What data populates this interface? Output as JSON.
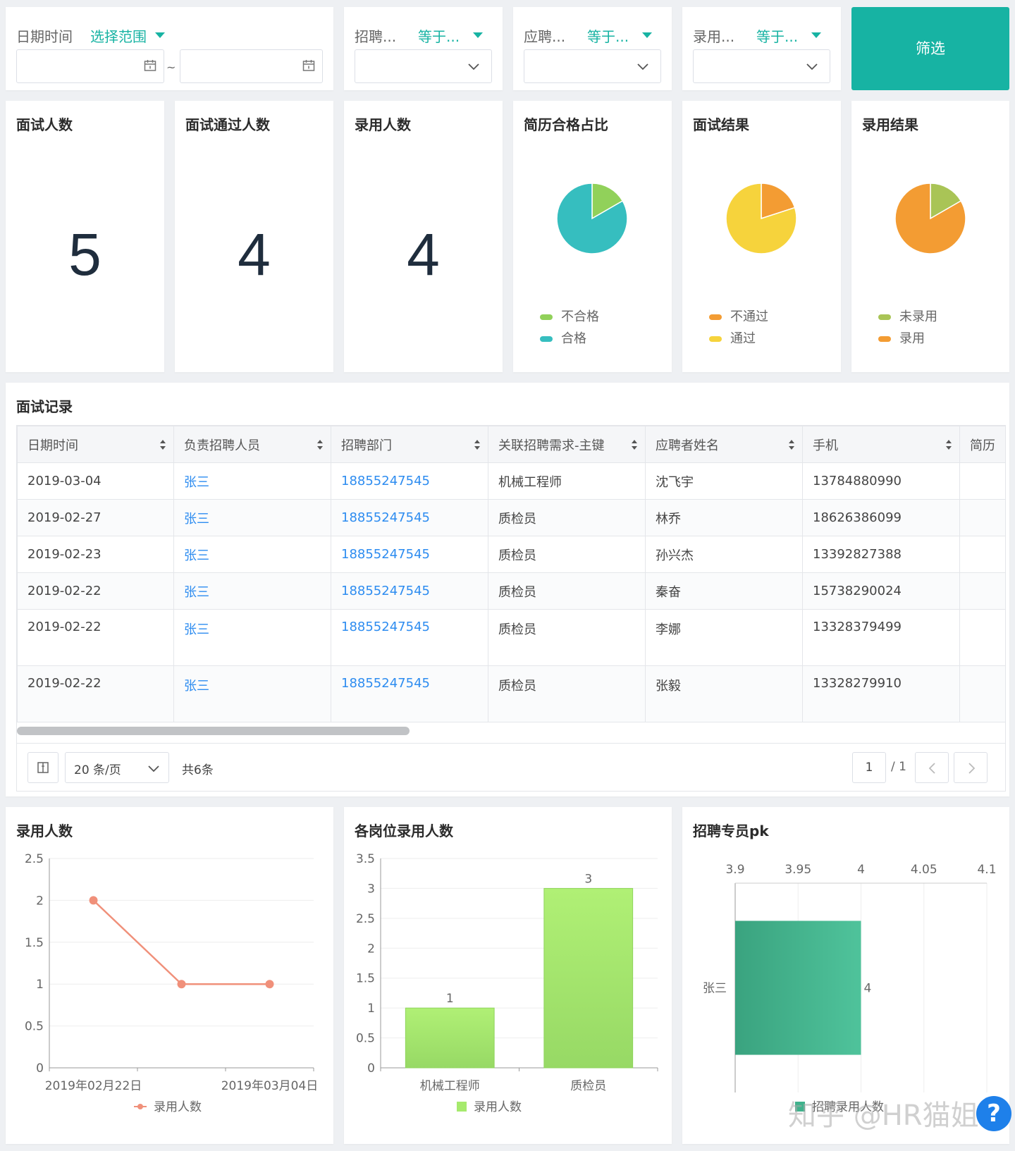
{
  "filters": {
    "date": {
      "label": "日期时间",
      "range": "选择范围",
      "separator": "~"
    },
    "recruiter": {
      "label": "招聘...",
      "op": "等于..."
    },
    "applicant": {
      "label": "应聘...",
      "op": "等于..."
    },
    "hire": {
      "label": "录用...",
      "op": "等于..."
    },
    "submit_label": "筛选"
  },
  "kpis": [
    {
      "title": "面试人数",
      "value": "5"
    },
    {
      "title": "面试通过人数",
      "value": "4"
    },
    {
      "title": "录用人数",
      "value": "4"
    }
  ],
  "pies": [
    {
      "title": "简历合格占比",
      "legend": [
        {
          "label": "不合格",
          "color": "#91d15a"
        },
        {
          "label": "合格",
          "color": "#36bebf"
        }
      ],
      "slices": [
        {
          "label": "不合格",
          "value": 1,
          "color": "#91d15a"
        },
        {
          "label": "合格",
          "value": 5,
          "color": "#36bebf"
        }
      ]
    },
    {
      "title": "面试结果",
      "legend": [
        {
          "label": "不通过",
          "color": "#f39c33"
        },
        {
          "label": "通过",
          "color": "#f6d33c"
        }
      ],
      "slices": [
        {
          "label": "不通过",
          "value": 1,
          "color": "#f39c33"
        },
        {
          "label": "通过",
          "value": 4,
          "color": "#f6d33c"
        }
      ]
    },
    {
      "title": "录用结果",
      "legend": [
        {
          "label": "未录用",
          "color": "#a9c456"
        },
        {
          "label": "录用",
          "color": "#f39c33"
        }
      ],
      "slices": [
        {
          "label": "未录用",
          "value": 1,
          "color": "#a9c456"
        },
        {
          "label": "录用",
          "value": 5,
          "color": "#f39c33"
        }
      ]
    }
  ],
  "records": {
    "title": "面试记录",
    "columns": [
      "日期时间",
      "负责招聘人员",
      "招聘部门",
      "关联招聘需求-主键",
      "应聘者姓名",
      "手机",
      "简历"
    ],
    "rows": [
      [
        "2019-03-04",
        "张三",
        "18855247545",
        "机械工程师",
        "沈飞宇",
        "13784880990",
        ""
      ],
      [
        "2019-02-27",
        "张三",
        "18855247545",
        "质检员",
        "林乔",
        "18626386099",
        ""
      ],
      [
        "2019-02-23",
        "张三",
        "18855247545",
        "质检员",
        "孙兴杰",
        "13392827388",
        ""
      ],
      [
        "2019-02-22",
        "张三",
        "18855247545",
        "质检员",
        "秦奋",
        "15738290024",
        ""
      ],
      [
        "2019-02-22",
        "张三",
        "18855247545",
        "质检员",
        "李娜",
        "13328379499",
        ""
      ],
      [
        "2019-02-22",
        "张三",
        "18855247545",
        "质检员",
        "张毅",
        "13328279910",
        ""
      ]
    ],
    "page_size": "20 条/页",
    "total": "共6条",
    "page": "1",
    "page_total": "/ 1"
  },
  "watermark": "知乎 @HR猫姐",
  "help_label": "?",
  "chart_data": [
    {
      "type": "line",
      "title": "录用人数",
      "x": [
        "2019年02月22日",
        "",
        "2019年03月04日"
      ],
      "tick_labels": [
        "2019年02月22日",
        "2019年03月04日"
      ],
      "series": [
        {
          "name": "录用人数",
          "values": [
            2,
            1,
            1
          ],
          "color": "#f0907a"
        }
      ],
      "y_ticks": [
        "0",
        "0.5",
        "1",
        "1.5",
        "2",
        "2.5"
      ],
      "ylim": [
        0,
        2.5
      ]
    },
    {
      "type": "bar",
      "title": "各岗位录用人数",
      "categories": [
        "机械工程师",
        "质检员"
      ],
      "series": [
        {
          "name": "录用人数",
          "values": [
            1,
            3
          ],
          "color": "#a6ea6d"
        }
      ],
      "y_ticks": [
        "0",
        "0.5",
        "1",
        "1.5",
        "2",
        "2.5",
        "3",
        "3.5"
      ],
      "ylim": [
        0,
        3.5
      ]
    },
    {
      "type": "bar",
      "orientation": "horizontal",
      "title": "招聘专员pk",
      "categories": [
        "张三"
      ],
      "series": [
        {
          "name": "招聘录用人数",
          "values": [
            4
          ],
          "color": "#3fb28c"
        }
      ],
      "x_ticks": [
        "3.9",
        "3.95",
        "4",
        "4.05",
        "4.1"
      ],
      "xlim": [
        3.9,
        4.1
      ]
    }
  ]
}
